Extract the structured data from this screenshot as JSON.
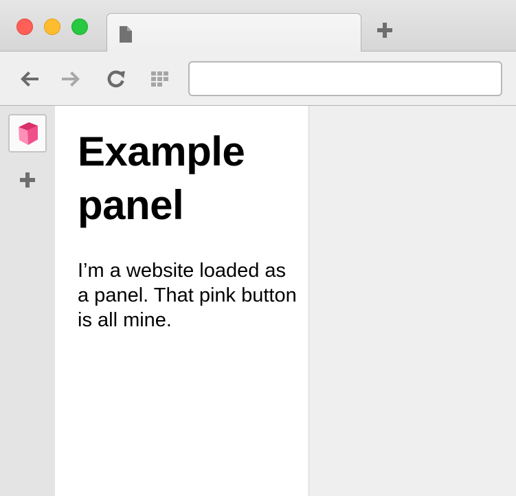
{
  "window": {
    "tab_title": "",
    "url_value": "",
    "icons": {
      "close": "traffic-close",
      "minimize": "traffic-minimize",
      "maximize": "traffic-maximize",
      "tab": "document-icon",
      "new_tab": "plus-icon",
      "back": "arrow-left-icon",
      "forward": "arrow-right-icon",
      "reload": "reload-icon",
      "apps": "grid-icon"
    },
    "colors": {
      "close": "#fe5f57",
      "minimize": "#febc2e",
      "maximize": "#28c840",
      "panel_icon": "#f0508a"
    }
  },
  "sidebar": {
    "items": [
      {
        "icon": "pink-cube-icon",
        "active": true
      },
      {
        "icon": "plus-icon"
      }
    ]
  },
  "panel": {
    "title": "Example panel",
    "body": "I’m a website loaded as a panel. That pink button is all mine."
  }
}
